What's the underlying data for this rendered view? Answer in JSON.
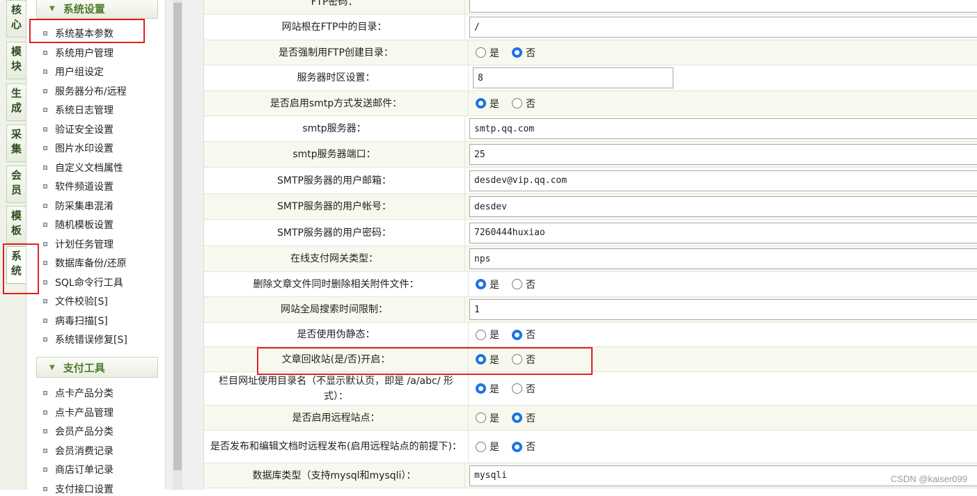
{
  "vertical_tabs": [
    {
      "label": "核心"
    },
    {
      "label": "模块"
    },
    {
      "label": "生成"
    },
    {
      "label": "采集"
    },
    {
      "label": "会员"
    },
    {
      "label": "模板"
    },
    {
      "label": "系统",
      "active": true
    }
  ],
  "menu": {
    "group1": {
      "title": "系统设置",
      "items": [
        "系统基本参数",
        "系统用户管理",
        "用户组设定",
        "服务器分布/远程",
        "系统日志管理",
        "验证安全设置",
        "图片水印设置",
        "自定义文档属性",
        "软件频道设置",
        "防采集串混淆",
        "随机模板设置",
        "计划任务管理",
        "数据库备份/还原",
        "SQL命令行工具",
        "文件校验[S]",
        "病毒扫描[S]",
        "系统错误修复[S]"
      ]
    },
    "group2": {
      "title": "支付工具",
      "items": [
        "点卡产品分类",
        "点卡产品管理",
        "会员产品分类",
        "会员消费记录",
        "商店订单记录",
        "支付接口设置"
      ]
    }
  },
  "form": {
    "top_partial_label": "FTP密码：",
    "yes": "是",
    "no": "否",
    "rows": [
      {
        "label": "网站根在FTP中的目录：",
        "type": "text",
        "value": "/"
      },
      {
        "label": "是否强制用FTP创建目录：",
        "type": "radio",
        "value": "no"
      },
      {
        "label": "服务器时区设置：",
        "type": "text-narrow",
        "value": "8"
      },
      {
        "label": "是否启用smtp方式发送邮件：",
        "type": "radio",
        "value": "yes"
      },
      {
        "label": "smtp服务器：",
        "type": "text",
        "value": "smtp.qq.com"
      },
      {
        "label": "smtp服务器端口：",
        "type": "text",
        "value": "25"
      },
      {
        "label": "SMTP服务器的用户邮箱：",
        "type": "text",
        "value": "desdev@vip.qq.com"
      },
      {
        "label": "SMTP服务器的用户帐号：",
        "type": "text",
        "value": "desdev"
      },
      {
        "label": "SMTP服务器的用户密码：",
        "type": "text",
        "value": "7260444huxiao"
      },
      {
        "label": "在线支付网关类型：",
        "type": "text",
        "value": "nps"
      },
      {
        "label": "删除文章文件同时删除相关附件文件：",
        "type": "radio",
        "value": "yes"
      },
      {
        "label": "网站全局搜索时间限制：",
        "type": "text",
        "value": "1"
      },
      {
        "label": "是否使用伪静态：",
        "type": "radio",
        "value": "no"
      },
      {
        "label": "文章回收站(是/否)开启：",
        "type": "radio",
        "value": "yes"
      },
      {
        "label": "栏目网址使用目录名（不显示默认页，即是 /a/abc/ 形式）：",
        "type": "radio",
        "value": "yes"
      },
      {
        "label": "是否启用远程站点：",
        "type": "radio",
        "value": "no"
      },
      {
        "label": "是否发布和编辑文档时远程发布(启用远程站点的前提下)：",
        "type": "radio",
        "value": "no"
      },
      {
        "label": "数据库类型（支持mysql和mysqli）：",
        "type": "text",
        "value": "mysqli"
      }
    ]
  },
  "watermark": "CSDN @kaiser099",
  "colors": {
    "highlight": "#e02020",
    "radio_selected": "#1a73e8",
    "group_title": "#4d7a2a"
  }
}
